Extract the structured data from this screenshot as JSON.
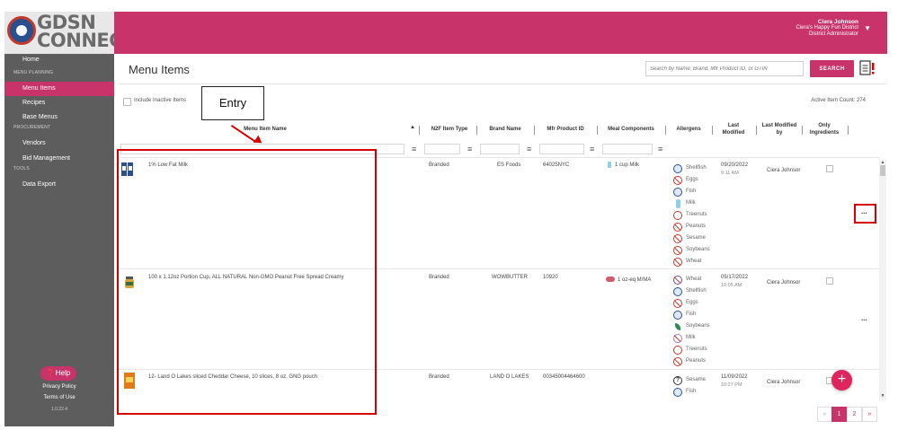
{
  "logo": {
    "line1": "GDSN",
    "line2": "CONNECT"
  },
  "sidebar": {
    "home": "Home",
    "section_menu_planning": "MENU PLANNING",
    "menu_items": "Menu Items",
    "recipes": "Recipes",
    "base_menus": "Base Menus",
    "section_procurement": "PROCUREMENT",
    "vendors": "Vendors",
    "bid_management": "Bid Management",
    "section_tools": "TOOLS",
    "data_export": "Data Export",
    "help": "Help",
    "privacy": "Privacy Policy",
    "terms": "Terms of Use",
    "version": "1.0.22.4"
  },
  "user": {
    "name": "Ciera Johnson",
    "district": "Ciera's Happy Fun District",
    "role": "District Administrator"
  },
  "page": {
    "title": "Menu Items",
    "search_placeholder": "Search by Name, Brand, Mfr Product ID, or GTIN",
    "search_label": "SEARCH",
    "include_inactive": "Include Inactive Items",
    "active_count": "Active Item Count: 274",
    "callout": "Entry"
  },
  "columns": {
    "name": "Menu Item Name",
    "n2f": "N2F Item Type",
    "brand": "Brand Name",
    "mfr": "Mfr Product ID",
    "meal": "Meal Components",
    "allergens": "Allergens",
    "last_modified": "Last Modified",
    "modified_by": "Last Modified by",
    "only_ingredients": "Only Ingredients"
  },
  "rows": [
    {
      "name": "1% Low Fat Milk",
      "type": "Branded",
      "brand": "ES Foods",
      "mfr": "64025NYC",
      "meal": "1 cup Milk",
      "allergens": [
        "Shellfish",
        "Eggs",
        "Fish",
        "Milk",
        "Treenuts",
        "Peanuts",
        "Sesame",
        "Soybeans",
        "Wheat"
      ],
      "date": "09/20/2022",
      "time": "9:11 AM",
      "by": "Ciera Johnsor",
      "more": "..."
    },
    {
      "name": "100 x 1.12oz Portion Cup, ALL NATURAL Non-GMO Peanut Free Spread Creamy",
      "type": "Branded",
      "brand": "WOWBUTTER",
      "mfr": "10920",
      "meal": "1 oz-eq M/MA",
      "allergens": [
        "Wheat",
        "Shellfish",
        "Eggs",
        "Fish",
        "Soybeans",
        "Milk",
        "Treenuts",
        "Peanuts"
      ],
      "date": "05/17/2022",
      "time": "10:05 AM",
      "by": "Ciera Johnsor",
      "more": "..."
    },
    {
      "name": "12- Land O Lakes sliced Cheddar Cheese, 10 slices, 8 oz. GNG pouch",
      "type": "Branded",
      "brand": "LAND O LAKES",
      "mfr": "00345004464600",
      "meal": "",
      "allergens": [
        "Sesame",
        "Fish"
      ],
      "date": "11/09/2022",
      "time": "10:27 PM",
      "by": "Ciera Johnsor"
    }
  ],
  "pagination": {
    "prev": "«",
    "page1": "1",
    "page2": "2",
    "next": "»"
  },
  "fab": "+"
}
